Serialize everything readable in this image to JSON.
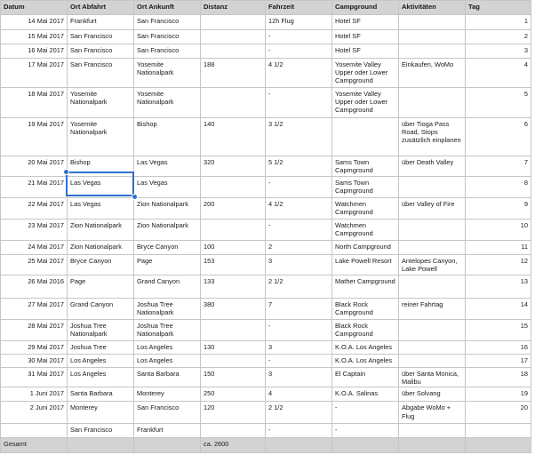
{
  "headers": {
    "datum": "Datum",
    "ort_abfahrt": "Ort Abfahrt",
    "ort_ankunft": "Ort Ankunft",
    "distanz": "Distanz",
    "fahrzeit": "Fahrzeit",
    "campground": "Campground",
    "aktivitaeten": "Aktivitäten",
    "tag": "Tag"
  },
  "rows": [
    {
      "datum": "14 Mai 2017",
      "abfahrt": "Frankfurt",
      "ankunft": "San Francisco",
      "distanz": "",
      "fahrzeit": "12h Flug",
      "campground": "Hotel SF",
      "aktivitaeten": "",
      "tag": "1"
    },
    {
      "datum": "15 Mai 2017",
      "abfahrt": "San Francisco",
      "ankunft": "San Francisco",
      "distanz": "",
      "fahrzeit": "-",
      "campground": "Hotel SF",
      "aktivitaeten": "",
      "tag": "2"
    },
    {
      "datum": "16 Mai 2017",
      "abfahrt": "San Francisco",
      "ankunft": "San Francisco",
      "distanz": "",
      "fahrzeit": "-",
      "campground": "Hotel SF",
      "aktivitaeten": "",
      "tag": "3"
    },
    {
      "datum": "17 Mai 2017",
      "abfahrt": "San Francisco",
      "ankunft": "Yosemite Nationalpark",
      "distanz": "188",
      "fahrzeit": "4 1/2",
      "campground": "Yosemite Valley Upper oder Lower Campground",
      "aktivitaeten": "Einkaufen, WoMo",
      "tag": "4"
    },
    {
      "datum": "18 Mai 2017",
      "abfahrt": "Yosemite Nationalpark",
      "ankunft": "Yosemite Nationalpark",
      "distanz": "",
      "fahrzeit": "-",
      "campground": "Yosemite Valley Upper oder Lower Campground",
      "aktivitaeten": "",
      "tag": "5"
    },
    {
      "datum": "19 Mai 2017",
      "abfahrt": "Yosemite Nationalpark",
      "ankunft": "Bishop",
      "distanz": "140",
      "fahrzeit": "3 1/2",
      "campground": "",
      "aktivitaeten": "über Tioga Pass Road, Stops zusätzlich einplanen",
      "tag": "6"
    },
    {
      "datum": "20 Mai 2017",
      "abfahrt": "Bishop",
      "ankunft": "Las Vegas",
      "distanz": "320",
      "fahrzeit": "5 1/2",
      "campground": "Sams Town Capmground",
      "aktivitaeten": "über Death Valley",
      "tag": "7"
    },
    {
      "datum": "21 Mai 2017",
      "abfahrt": "Las Vegas",
      "ankunft": "Las Vegas",
      "distanz": "",
      "fahrzeit": "-",
      "campground": "Sams Town Capmground",
      "aktivitaeten": "",
      "tag": "8"
    },
    {
      "datum": "22 Mai 2017",
      "abfahrt": "Las Vegas",
      "ankunft": "Zion Nationalpark",
      "distanz": "200",
      "fahrzeit": "4 1/2",
      "campground": "Watchmen Campground",
      "aktivitaeten": "über Valley of Fire",
      "tag": "9"
    },
    {
      "datum": "23 Mai 2017",
      "abfahrt": "Zion Nationalpark",
      "ankunft": "Zion Nationalpark",
      "distanz": "",
      "fahrzeit": "-",
      "campground": "Watchmen Campground",
      "aktivitaeten": "",
      "tag": "10"
    },
    {
      "datum": "24 Mai 2017",
      "abfahrt": "Zion Nationalpark",
      "ankunft": "Bryce Canyon",
      "distanz": "100",
      "fahrzeit": "2",
      "campground": "North Campground",
      "aktivitaeten": "",
      "tag": "11"
    },
    {
      "datum": "25 Mai 2017",
      "abfahrt": "Bryce Canyon",
      "ankunft": "Page",
      "distanz": "153",
      "fahrzeit": "3",
      "campground": "Lake Powell Resort",
      "aktivitaeten": "Antelopes Canyon, Lake Powell",
      "tag": "12"
    },
    {
      "datum": "26 Mai 2016",
      "abfahrt": "Page",
      "ankunft": "Grand Canyon",
      "distanz": "133",
      "fahrzeit": "2 1/2",
      "campground": "Mather Campground",
      "aktivitaeten": "",
      "tag": "13"
    },
    {
      "datum": "27 Mai 2017",
      "abfahrt": "Grand Canyon",
      "ankunft": "Joshua Tree Nationalpark",
      "distanz": "380",
      "fahrzeit": "7",
      "campground": "Black Rock Campground",
      "aktivitaeten": "reiner Fahrtag",
      "tag": "14"
    },
    {
      "datum": "28 Mai 2017",
      "abfahrt": "Joshua Tree Nationalpark",
      "ankunft": "Joshua Tree Nationalpark",
      "distanz": "",
      "fahrzeit": "-",
      "campground": "Black Rock Campground",
      "aktivitaeten": "",
      "tag": "15"
    },
    {
      "datum": "29 Mai 2017",
      "abfahrt": "Joshua Tree",
      "ankunft": "Los Angeles",
      "distanz": "130",
      "fahrzeit": "3",
      "campground": "K.O.A. Los Angeles",
      "aktivitaeten": "",
      "tag": "16"
    },
    {
      "datum": "30 Mai 2017",
      "abfahrt": "Los Angeles",
      "ankunft": "Los Angeles",
      "distanz": "",
      "fahrzeit": "-",
      "campground": "K.O.A. Los Angeles",
      "aktivitaeten": "",
      "tag": "17"
    },
    {
      "datum": "31 Mai 2017",
      "abfahrt": "Los Angeles",
      "ankunft": "Santa Barbara",
      "distanz": "150",
      "fahrzeit": "3",
      "campground": "El Captain",
      "aktivitaeten": "über Santa Monica, Malibu",
      "tag": "18"
    },
    {
      "datum": "1 Juni 2017",
      "abfahrt": "Santa Barbara",
      "ankunft": "Monterey",
      "distanz": "250",
      "fahrzeit": "4",
      "campground": "K.O.A. Salinas",
      "aktivitaeten": "über Solvang",
      "tag": "19"
    },
    {
      "datum": "2 Juni 2017",
      "abfahrt": "Monterey",
      "ankunft": "San Francisco",
      "distanz": "120",
      "fahrzeit": "2 1/2",
      "campground": "-",
      "aktivitaeten": "Abgabe WoMo + Flug",
      "tag": "20"
    },
    {
      "datum": "",
      "abfahrt": "San Francisco",
      "ankunft": "Frankfurt",
      "distanz": "",
      "fahrzeit": "-",
      "campground": "-",
      "aktivitaeten": "",
      "tag": ""
    }
  ],
  "total": {
    "label": "Gesamt",
    "distanz": "ca. 2600"
  },
  "selection": {
    "cell_text": "Las Vegas",
    "accent": "#2f6fd0"
  },
  "colors": {
    "header_bg": "#d3d3d3",
    "grid": "#c6c6c6"
  }
}
